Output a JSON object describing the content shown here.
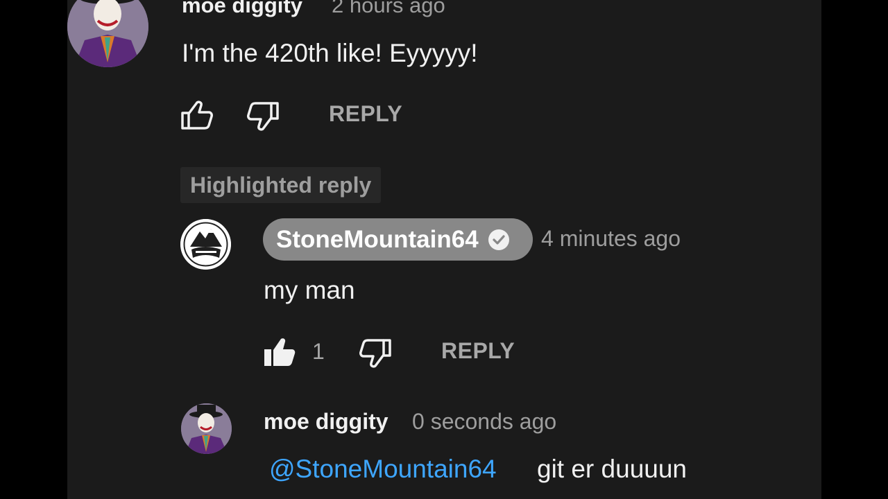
{
  "comment": {
    "author": "moe diggity",
    "time": "2 hours ago",
    "text": "I'm the 420th like! Eyyyyy!",
    "reply_label": "REPLY"
  },
  "highlight_chip": "Highlighted reply",
  "creator_reply": {
    "author": "StoneMountain64",
    "time": "4 minutes ago",
    "text": "my man",
    "like_count": "1",
    "reply_label": "REPLY"
  },
  "user_reply": {
    "author": "moe diggity",
    "time": "0 seconds ago",
    "mention": "@StoneMountain64",
    "text": "git er duuuun"
  },
  "colors": {
    "page_bg": "#000000",
    "panel_bg": "#1b1b1b",
    "text": "#f1f1f1",
    "secondary": "#9e9e9e",
    "creator_pill": "#888888",
    "mention": "#3ea6ff"
  },
  "icons": {
    "like": "thumbs-up-outline-icon",
    "like_active": "thumbs-up-filled-icon",
    "dislike": "thumbs-down-outline-icon",
    "verified": "verified-check-icon"
  }
}
